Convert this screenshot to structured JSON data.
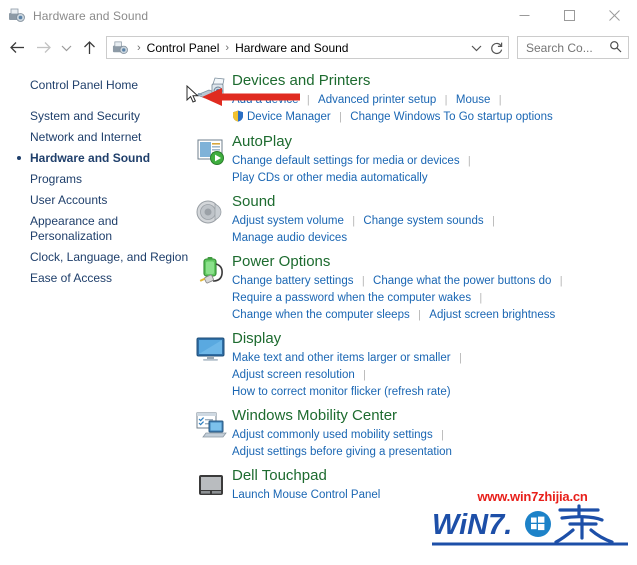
{
  "window": {
    "title": "Hardware and Sound",
    "title_icon": "devices-printers-icon",
    "minimize_label": "Minimize",
    "maximize_label": "Maximize",
    "close_label": "Close"
  },
  "toolbar": {
    "back_label": "Back",
    "forward_label": "Forward",
    "recent_label": "Recent locations",
    "up_label": "Up",
    "refresh_label": "Refresh",
    "breadcrumb": [
      "Control Panel",
      "Hardware and Sound"
    ],
    "breadcrumb_separator": "›",
    "dropdown_label": "Previous locations",
    "search": {
      "value": "",
      "placeholder": "Search Co...",
      "icon": "search-icon"
    }
  },
  "sidebar": {
    "home": "Control Panel Home",
    "items": [
      {
        "label": "System and Security",
        "current": false
      },
      {
        "label": "Network and Internet",
        "current": false
      },
      {
        "label": "Hardware and Sound",
        "current": true
      },
      {
        "label": "Programs",
        "current": false
      },
      {
        "label": "User Accounts",
        "current": false
      },
      {
        "label": "Appearance and\nPersonalization",
        "current": false
      },
      {
        "label": "Clock, Language, and Region",
        "current": false
      },
      {
        "label": "Ease of Access",
        "current": false
      }
    ]
  },
  "main": {
    "categories": [
      {
        "title": "Devices and Printers",
        "icon": "devices-printers-icon",
        "lines": [
          [
            {
              "text": "Add a device",
              "shield": false
            },
            {
              "text": "Advanced printer setup",
              "shield": false
            },
            {
              "text": "Mouse",
              "shield": false
            },
            {
              "text": "",
              "shield": false
            }
          ],
          [
            {
              "text": "Device Manager",
              "shield": true
            },
            {
              "text": "Change Windows To Go startup options",
              "shield": false
            }
          ]
        ]
      },
      {
        "title": "AutoPlay",
        "icon": "autoplay-icon",
        "lines": [
          [
            {
              "text": "Change default settings for media or devices",
              "shield": false
            },
            {
              "text": "",
              "shield": false
            }
          ],
          [
            {
              "text": "Play CDs or other media automatically",
              "shield": false
            }
          ]
        ]
      },
      {
        "title": "Sound",
        "icon": "sound-icon",
        "lines": [
          [
            {
              "text": "Adjust system volume",
              "shield": false
            },
            {
              "text": "Change system sounds",
              "shield": false
            },
            {
              "text": "",
              "shield": false
            }
          ],
          [
            {
              "text": "Manage audio devices",
              "shield": false
            }
          ]
        ]
      },
      {
        "title": "Power Options",
        "icon": "power-options-icon",
        "lines": [
          [
            {
              "text": "Change battery settings",
              "shield": false
            },
            {
              "text": "Change what the power buttons do",
              "shield": false
            },
            {
              "text": "",
              "shield": false
            }
          ],
          [
            {
              "text": "Require a password when the computer wakes",
              "shield": false
            },
            {
              "text": "",
              "shield": false
            }
          ],
          [
            {
              "text": "Change when the computer sleeps",
              "shield": false
            },
            {
              "text": "Adjust screen brightness",
              "shield": false
            }
          ]
        ]
      },
      {
        "title": "Display",
        "icon": "display-icon",
        "lines": [
          [
            {
              "text": "Make text and other items larger or smaller",
              "shield": false
            },
            {
              "text": "",
              "shield": false
            }
          ],
          [
            {
              "text": "Adjust screen resolution",
              "shield": false
            },
            {
              "text": "",
              "shield": false
            }
          ],
          [
            {
              "text": "How to correct monitor flicker (refresh rate)",
              "shield": false
            }
          ]
        ]
      },
      {
        "title": "Windows Mobility Center",
        "icon": "mobility-center-icon",
        "lines": [
          [
            {
              "text": "Adjust commonly used mobility settings",
              "shield": false
            },
            {
              "text": "",
              "shield": false
            }
          ],
          [
            {
              "text": "Adjust settings before giving a presentation",
              "shield": false
            }
          ]
        ]
      },
      {
        "title": "Dell Touchpad",
        "icon": "touchpad-icon",
        "lines": [
          [
            {
              "text": "Launch Mouse Control Panel",
              "shield": false
            }
          ]
        ]
      }
    ]
  },
  "annotations": {
    "arrow": {
      "name": "red-arrow-annotation",
      "color": "#e02b20",
      "points_to": "Devices and Printers"
    },
    "cursor": {
      "name": "mouse-cursor"
    },
    "watermark": {
      "url": "www.win7zhijia.cn",
      "logo_text": "WIN7.",
      "logo_char": "家",
      "url_color": "#e8201b",
      "logo_color": "#1d4fa8"
    }
  }
}
